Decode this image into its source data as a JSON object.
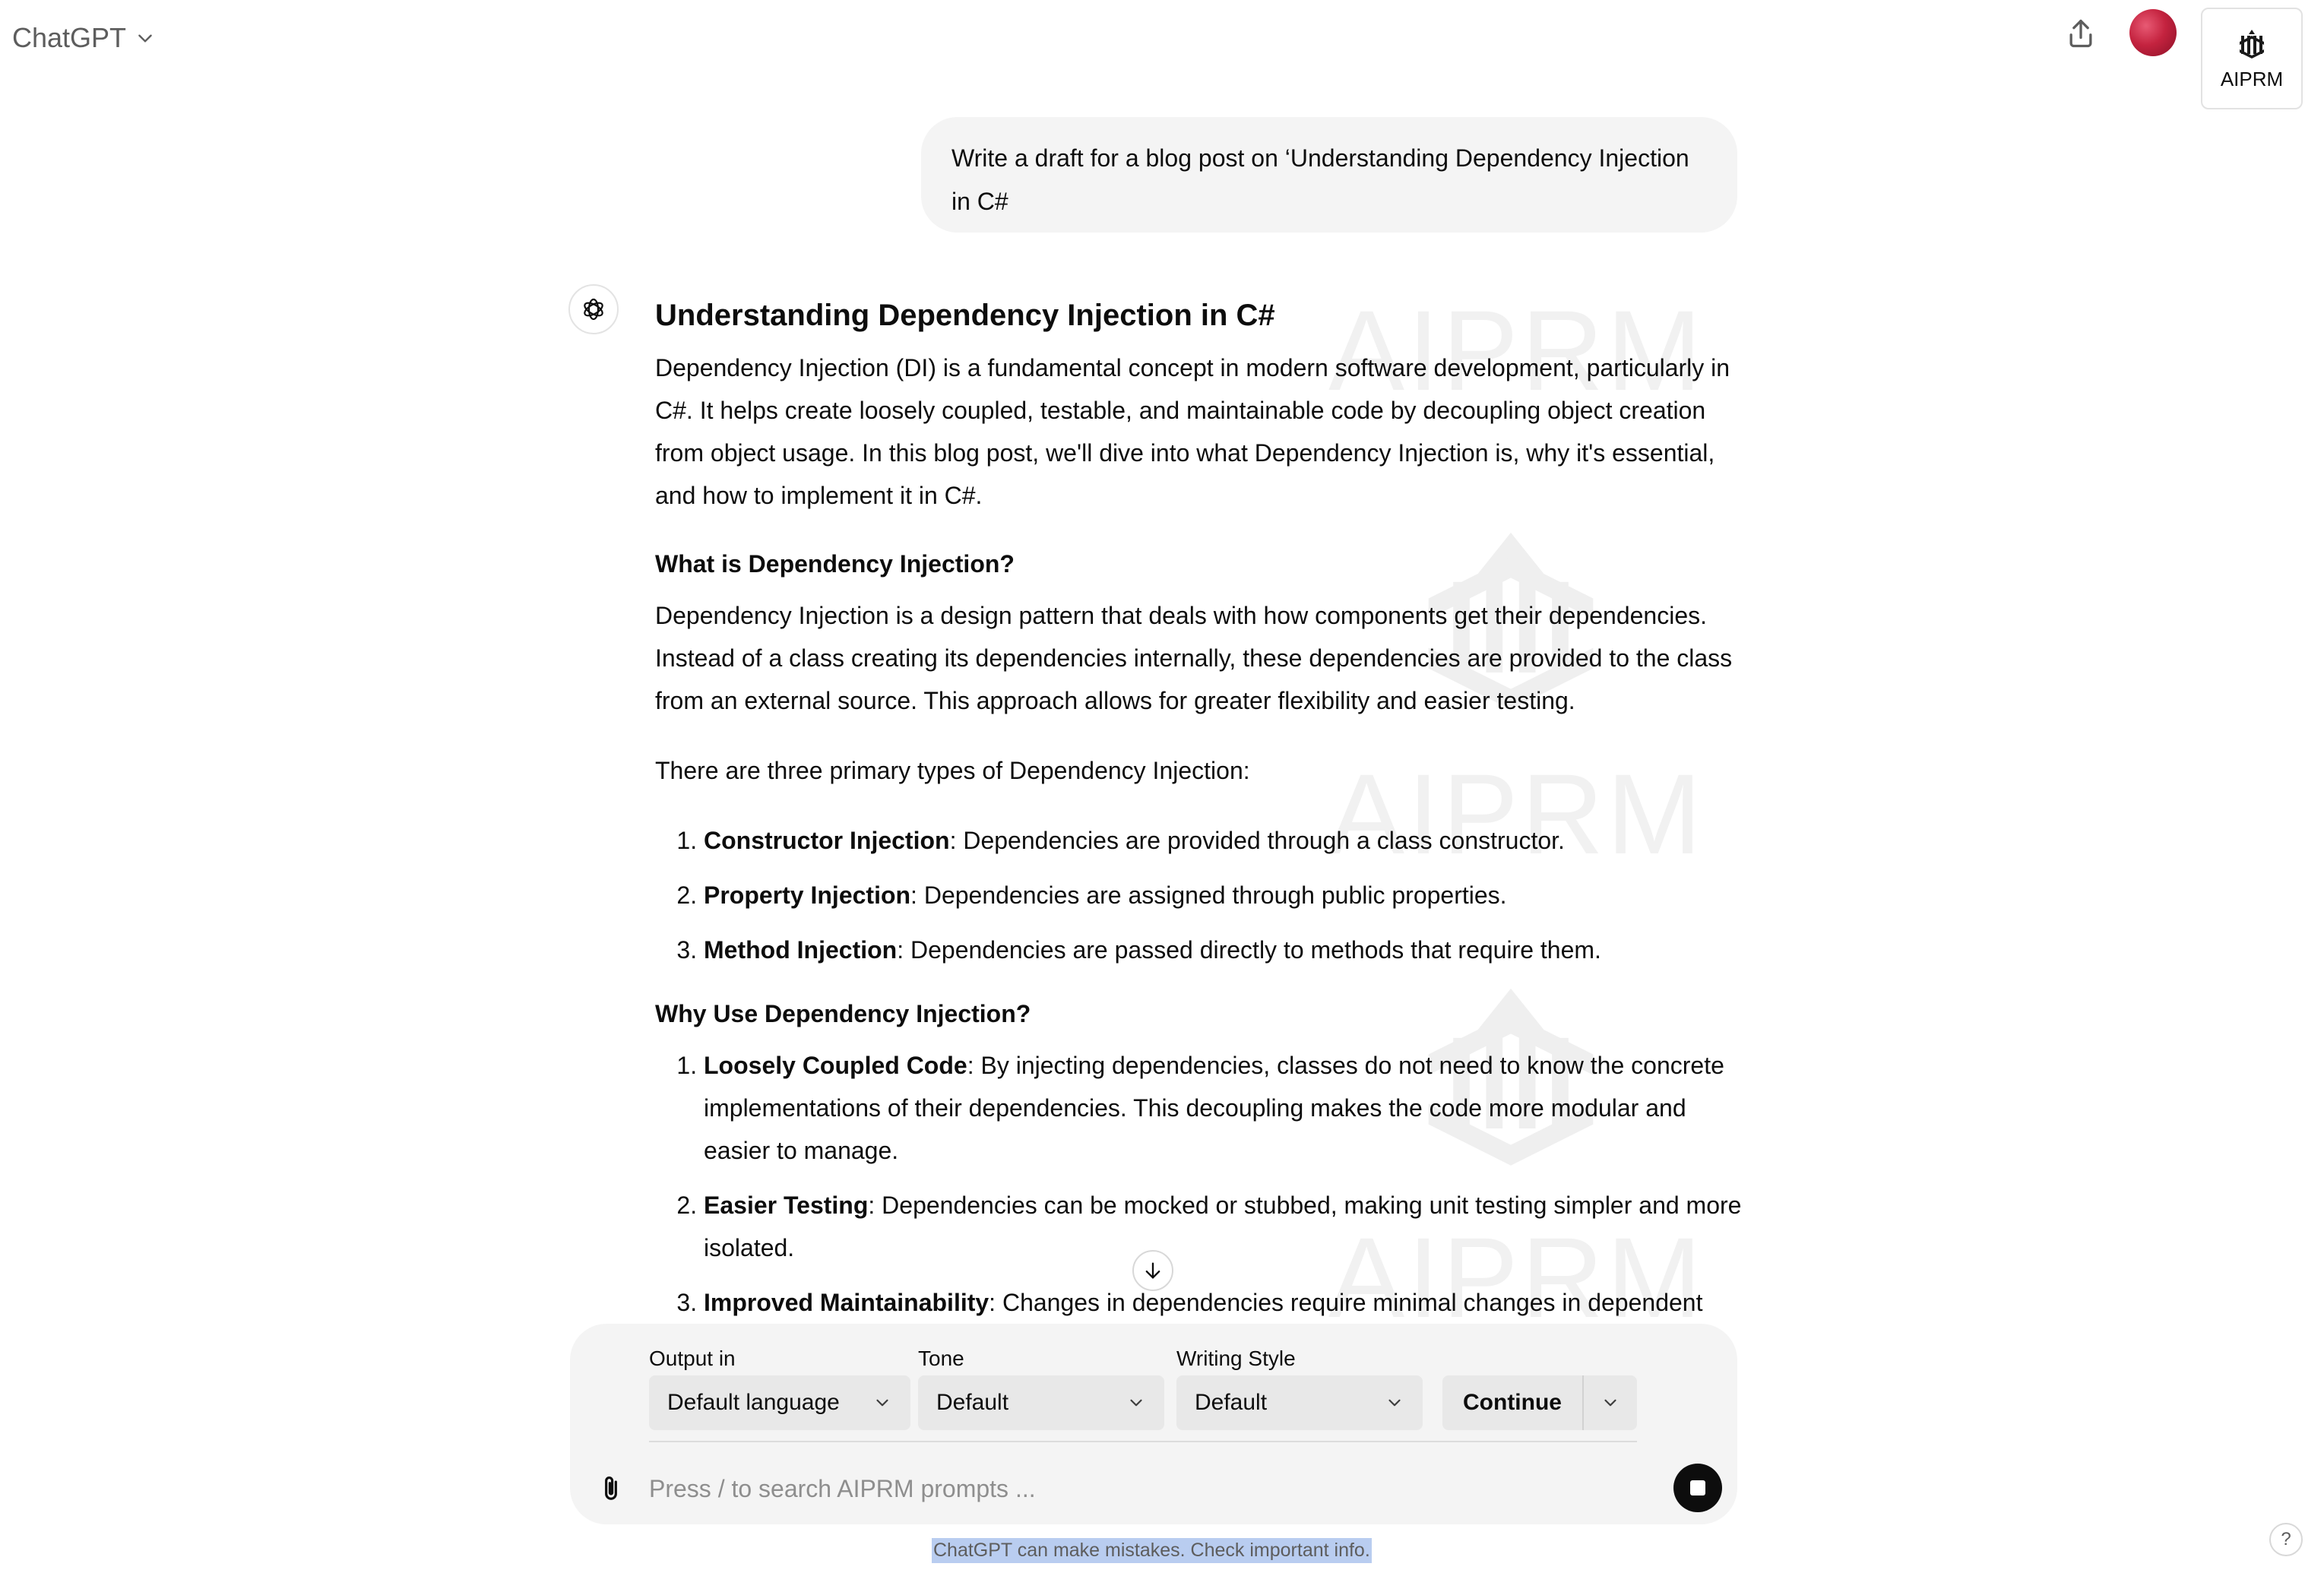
{
  "header": {
    "model_name": "ChatGPT",
    "aiprm_label": "AIPRM",
    "watermark_text": "AIPRM"
  },
  "conversation": {
    "user_message": "Write a draft for a blog post on ‘Understanding Dependency Injection in C#",
    "answer": {
      "title": "Understanding Dependency Injection in C#",
      "intro": "Dependency Injection (DI) is a fundamental concept in modern software development, particularly in C#. It helps create loosely coupled, testable, and maintainable code by decoupling object creation from object usage. In this blog post, we'll dive into what Dependency Injection is, why it's essential, and how to implement it in C#.",
      "section1_heading": "What is Dependency Injection?",
      "section1_text": "Dependency Injection is a design pattern that deals with how components get their dependencies. Instead of a class creating its dependencies internally, these dependencies are provided to the class from an external source. This approach allows for greater flexibility and easier testing.",
      "types_intro": "There are three primary types of Dependency Injection:",
      "types": [
        {
          "name": "Constructor Injection",
          "text": ": Dependencies are provided through a class constructor."
        },
        {
          "name": "Property Injection",
          "text": ": Dependencies are assigned through public properties."
        },
        {
          "name": "Method Injection",
          "text": ": Dependencies are passed directly to methods that require them."
        }
      ],
      "section2_heading": "Why Use Dependency Injection?",
      "reasons": [
        {
          "name": "Loosely Coupled Code",
          "text": ": By injecting dependencies, classes do not need to know the concrete implementations of their dependencies. This decoupling makes the code more modular and easier to manage."
        },
        {
          "name": "Easier Testing",
          "text": ": Dependencies can be mocked or stubbed, making unit testing simpler and more isolated."
        },
        {
          "name": "Improved Maintainability",
          "text": ": Changes in dependencies require minimal changes in dependent"
        }
      ]
    }
  },
  "composer": {
    "output_label": "Output in",
    "output_value": "Default language",
    "tone_label": "Tone",
    "tone_value": "Default",
    "style_label": "Writing Style",
    "style_value": "Default",
    "continue_label": "Continue",
    "placeholder": "Press / to search AIPRM prompts ..."
  },
  "footer": {
    "disclaimer": "ChatGPT can make mistakes. Check important info.",
    "help_label": "?"
  },
  "icons": {
    "model_switcher": "chevron-down-icon",
    "share": "share-icon",
    "aiprm": "aiprm-logo-icon",
    "assistant": "openai-logo-icon",
    "scroll": "arrow-down-icon",
    "attach": "paperclip-icon",
    "stop": "stop-icon"
  },
  "colors": {
    "bubble_bg": "#f4f4f4",
    "select_bg": "#e8e8e8",
    "stop_button": "#0d0d0d",
    "disclaimer_highlight": "#b9cdf0",
    "avatar": "#c4233f"
  }
}
